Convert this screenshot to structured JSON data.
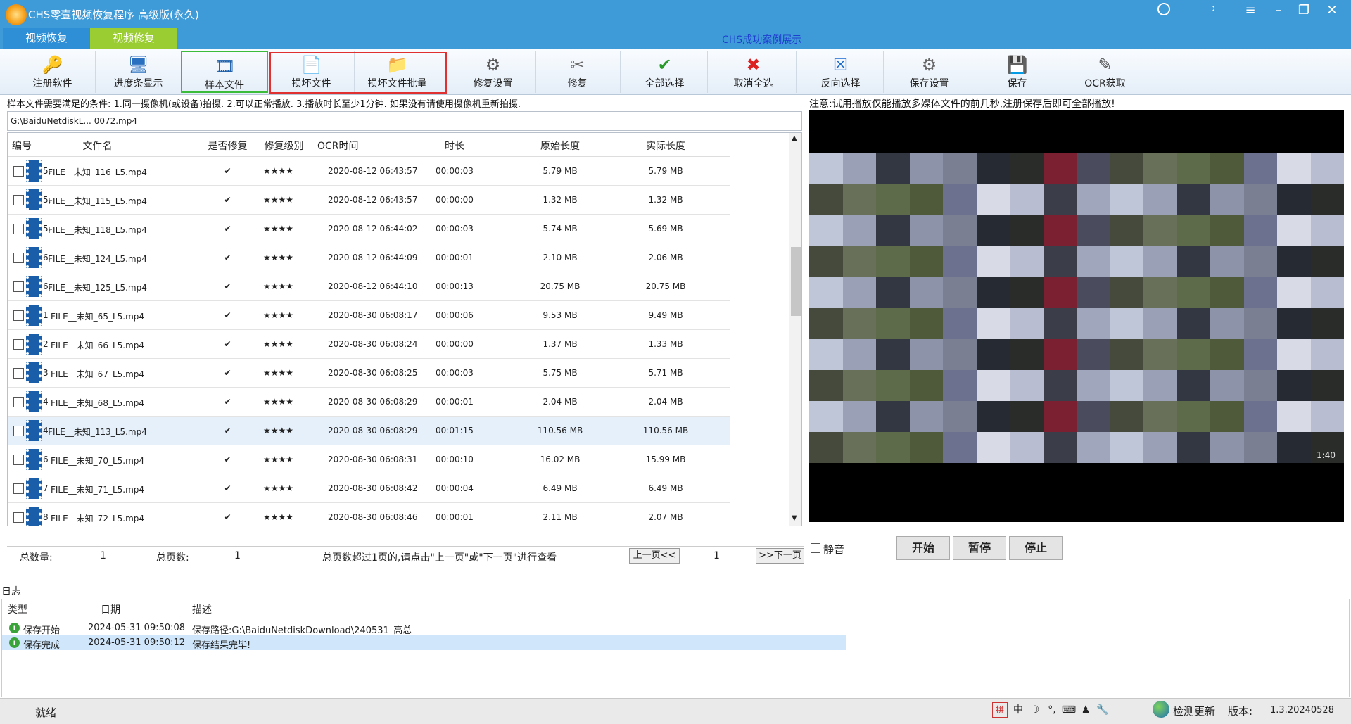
{
  "title": "CHS零壹视频恢复程序 高级版(永久)",
  "window_controls": [
    "≡",
    "–",
    "❐",
    "✕"
  ],
  "tabs": [
    "视频恢复",
    "视频修复"
  ],
  "success_link": "CHS成功案例展示",
  "toolbar": [
    {
      "label": "注册软件",
      "icon": "key-person-icon",
      "glyph": "🔑"
    },
    {
      "label": "进度条显示",
      "icon": "progress-display-icon",
      "glyph": "🖥"
    },
    {
      "label": "样本文件",
      "icon": "film-sample-icon",
      "glyph": "🎞"
    },
    {
      "label": "损坏文件",
      "icon": "damaged-file-icon",
      "glyph": "📄"
    },
    {
      "label": "损坏文件批量",
      "icon": "folder-batch-icon",
      "glyph": "📁"
    },
    {
      "label": "修复设置",
      "icon": "repair-settings-icon",
      "glyph": "⚙"
    },
    {
      "label": "修复",
      "icon": "tools-icon",
      "glyph": "✂"
    },
    {
      "label": "全部选择",
      "icon": "check-all-icon",
      "glyph": "✔"
    },
    {
      "label": "取消全选",
      "icon": "uncheck-all-icon",
      "glyph": "✖"
    },
    {
      "label": "反向选择",
      "icon": "invert-select-icon",
      "glyph": "☒"
    },
    {
      "label": "保存设置",
      "icon": "save-settings-icon",
      "glyph": "⚙"
    },
    {
      "label": "保存",
      "icon": "save-disk-icon",
      "glyph": "💾"
    },
    {
      "label": "OCR获取",
      "icon": "ocr-icon",
      "glyph": "✎"
    }
  ],
  "conditions_text": "样本文件需要满足的条件: 1.同一摄像机(或设备)拍摄. 2.可以正常播放. 3.播放时长至少1分钟. 如果没有请使用摄像机重新拍摄.",
  "sample_path": "G:\\BaiduNetdiskL...              0072.mp4",
  "table": {
    "headers": [
      "编号",
      "文件名",
      "是否修复",
      "修复级别",
      "OCR时间",
      "时长",
      "原始长度",
      "实际长度"
    ],
    "rows": [
      [
        "5.",
        "FILE__未知_116_L5.mp4",
        "✔",
        "★★★★",
        "2020-08-12 06:43:57",
        "00:00:03",
        "5.79 MB",
        "5.79 MB"
      ],
      [
        "5.",
        "FILE__未知_115_L5.mp4",
        "✔",
        "★★★★",
        "2020-08-12 06:43:57",
        "00:00:00",
        "1.32 MB",
        "1.32 MB"
      ],
      [
        "5.",
        "FILE__未知_118_L5.mp4",
        "✔",
        "★★★★",
        "2020-08-12 06:44:02",
        "00:00:03",
        "5.74 MB",
        "5.69 MB"
      ],
      [
        "6.",
        "FILE__未知_124_L5.mp4",
        "✔",
        "★★★★",
        "2020-08-12 06:44:09",
        "00:00:01",
        "2.10 MB",
        "2.06 MB"
      ],
      [
        "6.",
        "FILE__未知_125_L5.mp4",
        "✔",
        "★★★★",
        "2020-08-12 06:44:10",
        "00:00:13",
        "20.75 MB",
        "20.75 MB"
      ],
      [
        "1",
        "FILE__未知_65_L5.mp4",
        "✔",
        "★★★★",
        "2020-08-30 06:08:17",
        "00:00:06",
        "9.53 MB",
        "9.49 MB"
      ],
      [
        "2",
        "FILE__未知_66_L5.mp4",
        "✔",
        "★★★★",
        "2020-08-30 06:08:24",
        "00:00:00",
        "1.37 MB",
        "1.33 MB"
      ],
      [
        "3",
        "FILE__未知_67_L5.mp4",
        "✔",
        "★★★★",
        "2020-08-30 06:08:25",
        "00:00:03",
        "5.75 MB",
        "5.71 MB"
      ],
      [
        "4",
        "FILE__未知_68_L5.mp4",
        "✔",
        "★★★★",
        "2020-08-30 06:08:29",
        "00:00:01",
        "2.04 MB",
        "2.04 MB"
      ],
      [
        "4.",
        "FILE__未知_113_L5.mp4",
        "✔",
        "★★★★",
        "2020-08-30 06:08:29",
        "00:01:15",
        "110.56 MB",
        "110.56 MB"
      ],
      [
        "6",
        "FILE__未知_70_L5.mp4",
        "✔",
        "★★★★",
        "2020-08-30 06:08:31",
        "00:00:10",
        "16.02 MB",
        "15.99 MB"
      ],
      [
        "7",
        "FILE__未知_71_L5.mp4",
        "✔",
        "★★★★",
        "2020-08-30 06:08:42",
        "00:00:04",
        "6.49 MB",
        "6.49 MB"
      ],
      [
        "8",
        "FILE__未知_72_L5.mp4",
        "✔",
        "★★★★",
        "2020-08-30 06:08:46",
        "00:00:01",
        "2.11 MB",
        "2.07 MB"
      ]
    ],
    "selected_row": 9
  },
  "summary": {
    "total_label": "总数量:",
    "total_value": "1",
    "pages_label": "总页数:",
    "pages_value": "1",
    "hint": "总页数超过1页的,请点击\"上一页\"或\"下一页\"进行查看",
    "prev": "上一页<<",
    "page": "1",
    "next": ">>下一页"
  },
  "video": {
    "note": "注意:试用播放仅能播放多媒体文件的前几秒,注册保存后即可全部播放!",
    "timestamp": "1:40",
    "mute_label": "静音",
    "buttons": [
      "开始",
      "暂停",
      "停止"
    ]
  },
  "log": {
    "label": "日志",
    "headers": [
      "类型",
      "日期",
      "描述"
    ],
    "rows": [
      [
        "保存开始",
        "2024-05-31 09:50:08",
        "保存路径:G:\\BaiduNetdiskDownload\\240531_高总"
      ],
      [
        "保存完成",
        "2024-05-31 09:50:12",
        "保存结果完毕!"
      ]
    ]
  },
  "status": {
    "text": "就绪",
    "ime": [
      "中",
      "☽",
      "°,",
      "⌨",
      "♟",
      "🔧"
    ],
    "update": "检测更新",
    "version_label": "版本:",
    "version": "1.3.20240528"
  },
  "colors": {
    "title_bar": "#3f9ad8",
    "active_tab": "#9acd32",
    "tab_blue": "#2f8fd6"
  }
}
